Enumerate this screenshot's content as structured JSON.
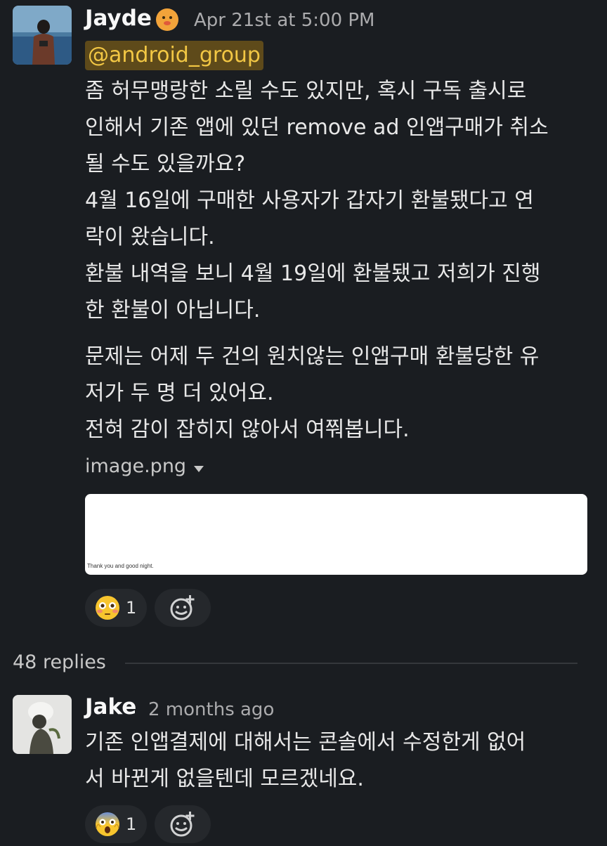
{
  "message": {
    "author": "Jayde",
    "timestamp": "Apr 21st at 5:00 PM",
    "mention": "@android_group",
    "lines": [
      "좀 허무맹랑한 소릴 수도 있지만, 혹시 구독 출시로",
      "인해서 기존 앱에 있던 remove ad 인앱구매가 취소",
      "될 수도 있을까요?",
      "4월 16일에 구매한 사용자가 갑자기 환불됐다고 연",
      "락이 왔습니다.",
      "환불 내역을 보니 4월 19일에 환불됐고 저희가 진행",
      "한 환불이 아닙니다.",
      "문제는 어제 두 건의 원치않는 인앱구매 환불당한 유",
      "저가 두 명 더 있어요.",
      "전혀 감이 잡히지 않아서 여쭤봅니다."
    ],
    "attachment": {
      "filename": "image.png",
      "caption": "Thank you and good night."
    },
    "reaction": {
      "emoji": "flushed-face",
      "count": "1"
    }
  },
  "thread": {
    "replies_label": "48 replies"
  },
  "reply": {
    "author": "Jake",
    "timestamp": "2 months ago",
    "lines": [
      "기존 인앱결제에 대해서는 콘솔에서 수정한게 없어",
      "서 바뀐게 없을텐데 모르겠네요."
    ],
    "reaction": {
      "emoji": "screaming-face",
      "count": "1"
    }
  }
}
